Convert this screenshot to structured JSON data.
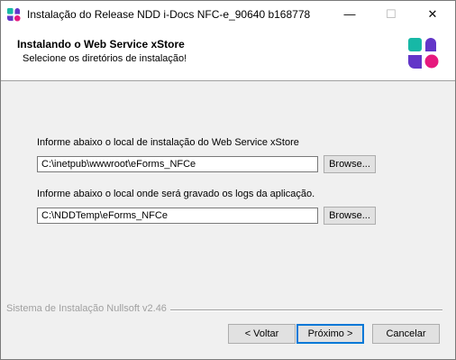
{
  "window": {
    "title": "Instalação do Release NDD i-Docs NFC-e_90640 b168778",
    "min_glyph": "—",
    "max_glyph": "☐",
    "close_glyph": "✕"
  },
  "header": {
    "title": "Instalando o Web Service xStore",
    "subtitle": "Selecione os diretórios de instalação!"
  },
  "fields": [
    {
      "label": "Informe abaixo o local de instalação do Web Service xStore",
      "value": "C:\\inetpub\\wwwroot\\eForms_NFCe",
      "browse_label": "Browse..."
    },
    {
      "label": "Informe abaixo o local onde será gravado os logs da aplicação.",
      "value": "C:\\NDDTemp\\eForms_NFCe",
      "browse_label": "Browse..."
    }
  ],
  "footer": {
    "brand": "Sistema de Instalação Nullsoft v2.46",
    "back_label": "< Voltar",
    "next_label": "Próximo >",
    "cancel_label": "Cancelar"
  },
  "icons": {
    "app": "ndd-logo-icon",
    "header_logo": "ndd-logo-icon"
  },
  "colors": {
    "logo_teal": "#17b8a6",
    "logo_purple": "#6236c8",
    "logo_pink": "#e6197e",
    "focus_blue": "#0078d7"
  }
}
